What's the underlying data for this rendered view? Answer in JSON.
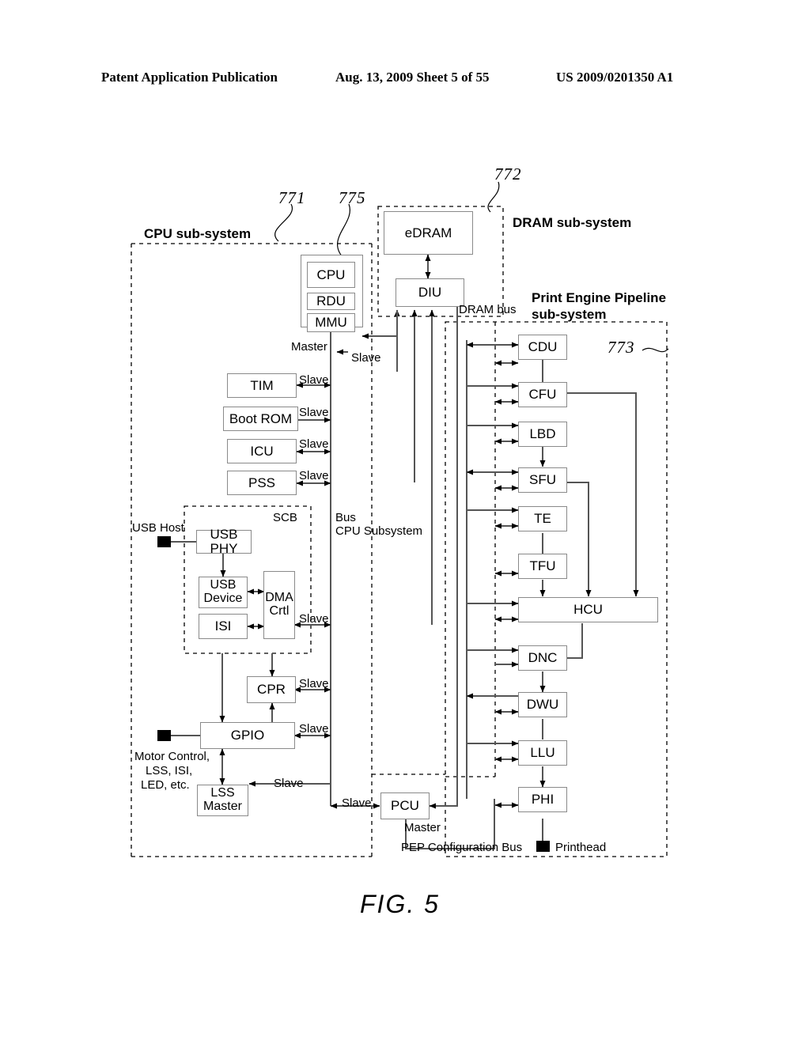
{
  "header": {
    "left": "Patent Application Publication",
    "center": "Aug. 13, 2009  Sheet 5 of 55",
    "right": "US 2009/0201350 A1"
  },
  "figure": {
    "caption": "FIG. 5",
    "subsystems": [
      {
        "id": "cpu",
        "label": "CPU sub-system",
        "ref": "771"
      },
      {
        "id": "dram",
        "label": "DRAM sub-system",
        "ref": "772"
      },
      {
        "id": "pep",
        "label": "Print Engine Pipeline\nsub-system",
        "ref": "773"
      }
    ],
    "refs": {
      "r771": "771",
      "r772": "772",
      "r773": "773",
      "r775": "775"
    },
    "subsystem_labels": {
      "cpu": "CPU sub-system",
      "dram": "DRAM sub-system",
      "pep_line1": "Print Engine Pipeline",
      "pep_line2": "sub-system"
    },
    "blocks": {
      "cpu_core": "CPU",
      "rdu": "RDU",
      "mmu": "MMU",
      "edram": "eDRAM",
      "diu": "DIU",
      "tim": "TIM",
      "boot_rom": "Boot ROM",
      "icu": "ICU",
      "pss": "PSS",
      "usb_phy": "USB PHY",
      "usb_device_l1": "USB",
      "usb_device_l2": "Device",
      "isi": "ISI",
      "dma_l1": "DMA",
      "dma_l2": "Crtl",
      "cpr": "CPR",
      "gpio": "GPIO",
      "lss_l1": "LSS",
      "lss_l2": "Master",
      "pcu": "PCU",
      "cdu": "CDU",
      "cfu": "CFU",
      "lbd": "LBD",
      "sfu": "SFU",
      "te": "TE",
      "tfu": "TFU",
      "hcu": "HCU",
      "dnc": "DNC",
      "dwu": "DWU",
      "llu": "LLU",
      "phi": "PHI"
    },
    "annotations": {
      "master_cpu": "Master",
      "slave_cpu": "Slave",
      "slave_tim": "Slave",
      "slave_bootrom": "Slave",
      "slave_icu": "Slave",
      "slave_pss": "Slave",
      "slave_dma": "Slave",
      "slave_cpr": "Slave",
      "slave_gpio": "Slave",
      "slave_lss": "Slave",
      "slave_pcu": "Slave",
      "master_pcu": "Master",
      "bus_l1": "Bus",
      "bus_l2": "CPU Subsystem",
      "dram_bus": "DRAM bus",
      "scb": "SCB",
      "usb_host": "USB Host",
      "motor_l1": "Motor Control,",
      "motor_l2": "LSS, ISI,",
      "motor_l3": "LED, etc.",
      "pep_config_bus": "PEP Configuration Bus",
      "printhead": "Printhead"
    }
  }
}
